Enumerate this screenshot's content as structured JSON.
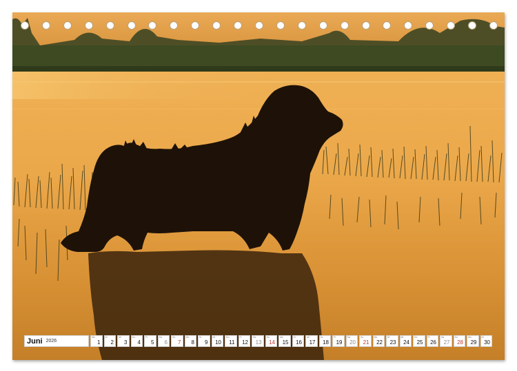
{
  "calendar": {
    "month": "Juni",
    "year": "2026",
    "days": [
      {
        "n": "1",
        "wd": "Mo",
        "kind": "weekday"
      },
      {
        "n": "2",
        "wd": "Di",
        "kind": "weekday"
      },
      {
        "n": "3",
        "wd": "Mi",
        "kind": "weekday"
      },
      {
        "n": "4",
        "wd": "Do",
        "kind": "weekday"
      },
      {
        "n": "5",
        "wd": "Fr",
        "kind": "weekday"
      },
      {
        "n": "6",
        "wd": "Sa",
        "kind": "weekend"
      },
      {
        "n": "7",
        "wd": "So",
        "kind": "sunday"
      },
      {
        "n": "8",
        "wd": "Mo",
        "kind": "weekday"
      },
      {
        "n": "9",
        "wd": "Di",
        "kind": "weekday"
      },
      {
        "n": "10",
        "wd": "Mi",
        "kind": "weekday"
      },
      {
        "n": "11",
        "wd": "Do",
        "kind": "weekday"
      },
      {
        "n": "12",
        "wd": "Fr",
        "kind": "weekday"
      },
      {
        "n": "13",
        "wd": "Sa",
        "kind": "weekend"
      },
      {
        "n": "14",
        "wd": "So",
        "kind": "sunday"
      },
      {
        "n": "15",
        "wd": "Mo",
        "kind": "weekday"
      },
      {
        "n": "16",
        "wd": "Di",
        "kind": "weekday"
      },
      {
        "n": "17",
        "wd": "Mi",
        "kind": "weekday"
      },
      {
        "n": "18",
        "wd": "Do",
        "kind": "weekday"
      },
      {
        "n": "19",
        "wd": "Fr",
        "kind": "weekday"
      },
      {
        "n": "20",
        "wd": "Sa",
        "kind": "weekend"
      },
      {
        "n": "21",
        "wd": "So",
        "kind": "sunday"
      },
      {
        "n": "22",
        "wd": "Mo",
        "kind": "weekday"
      },
      {
        "n": "23",
        "wd": "Di",
        "kind": "weekday"
      },
      {
        "n": "24",
        "wd": "Mi",
        "kind": "weekday"
      },
      {
        "n": "25",
        "wd": "Do",
        "kind": "weekday"
      },
      {
        "n": "26",
        "wd": "Fr",
        "kind": "weekday"
      },
      {
        "n": "27",
        "wd": "Sa",
        "kind": "weekend"
      },
      {
        "n": "28",
        "wd": "So",
        "kind": "sunday"
      },
      {
        "n": "29",
        "wd": "Mo",
        "kind": "weekday"
      },
      {
        "n": "30",
        "wd": "Di",
        "kind": "weekday"
      }
    ]
  },
  "binding": {
    "hole_count": 23
  },
  "photo": {
    "subject": "dog-silhouette",
    "colors": {
      "sky": "#e3a24a",
      "water_light": "#f0b453",
      "water_dark": "#b87320",
      "treeline": "#5a5a2a",
      "silhouette": "#1e1208",
      "sunday": "#c0392b"
    }
  }
}
